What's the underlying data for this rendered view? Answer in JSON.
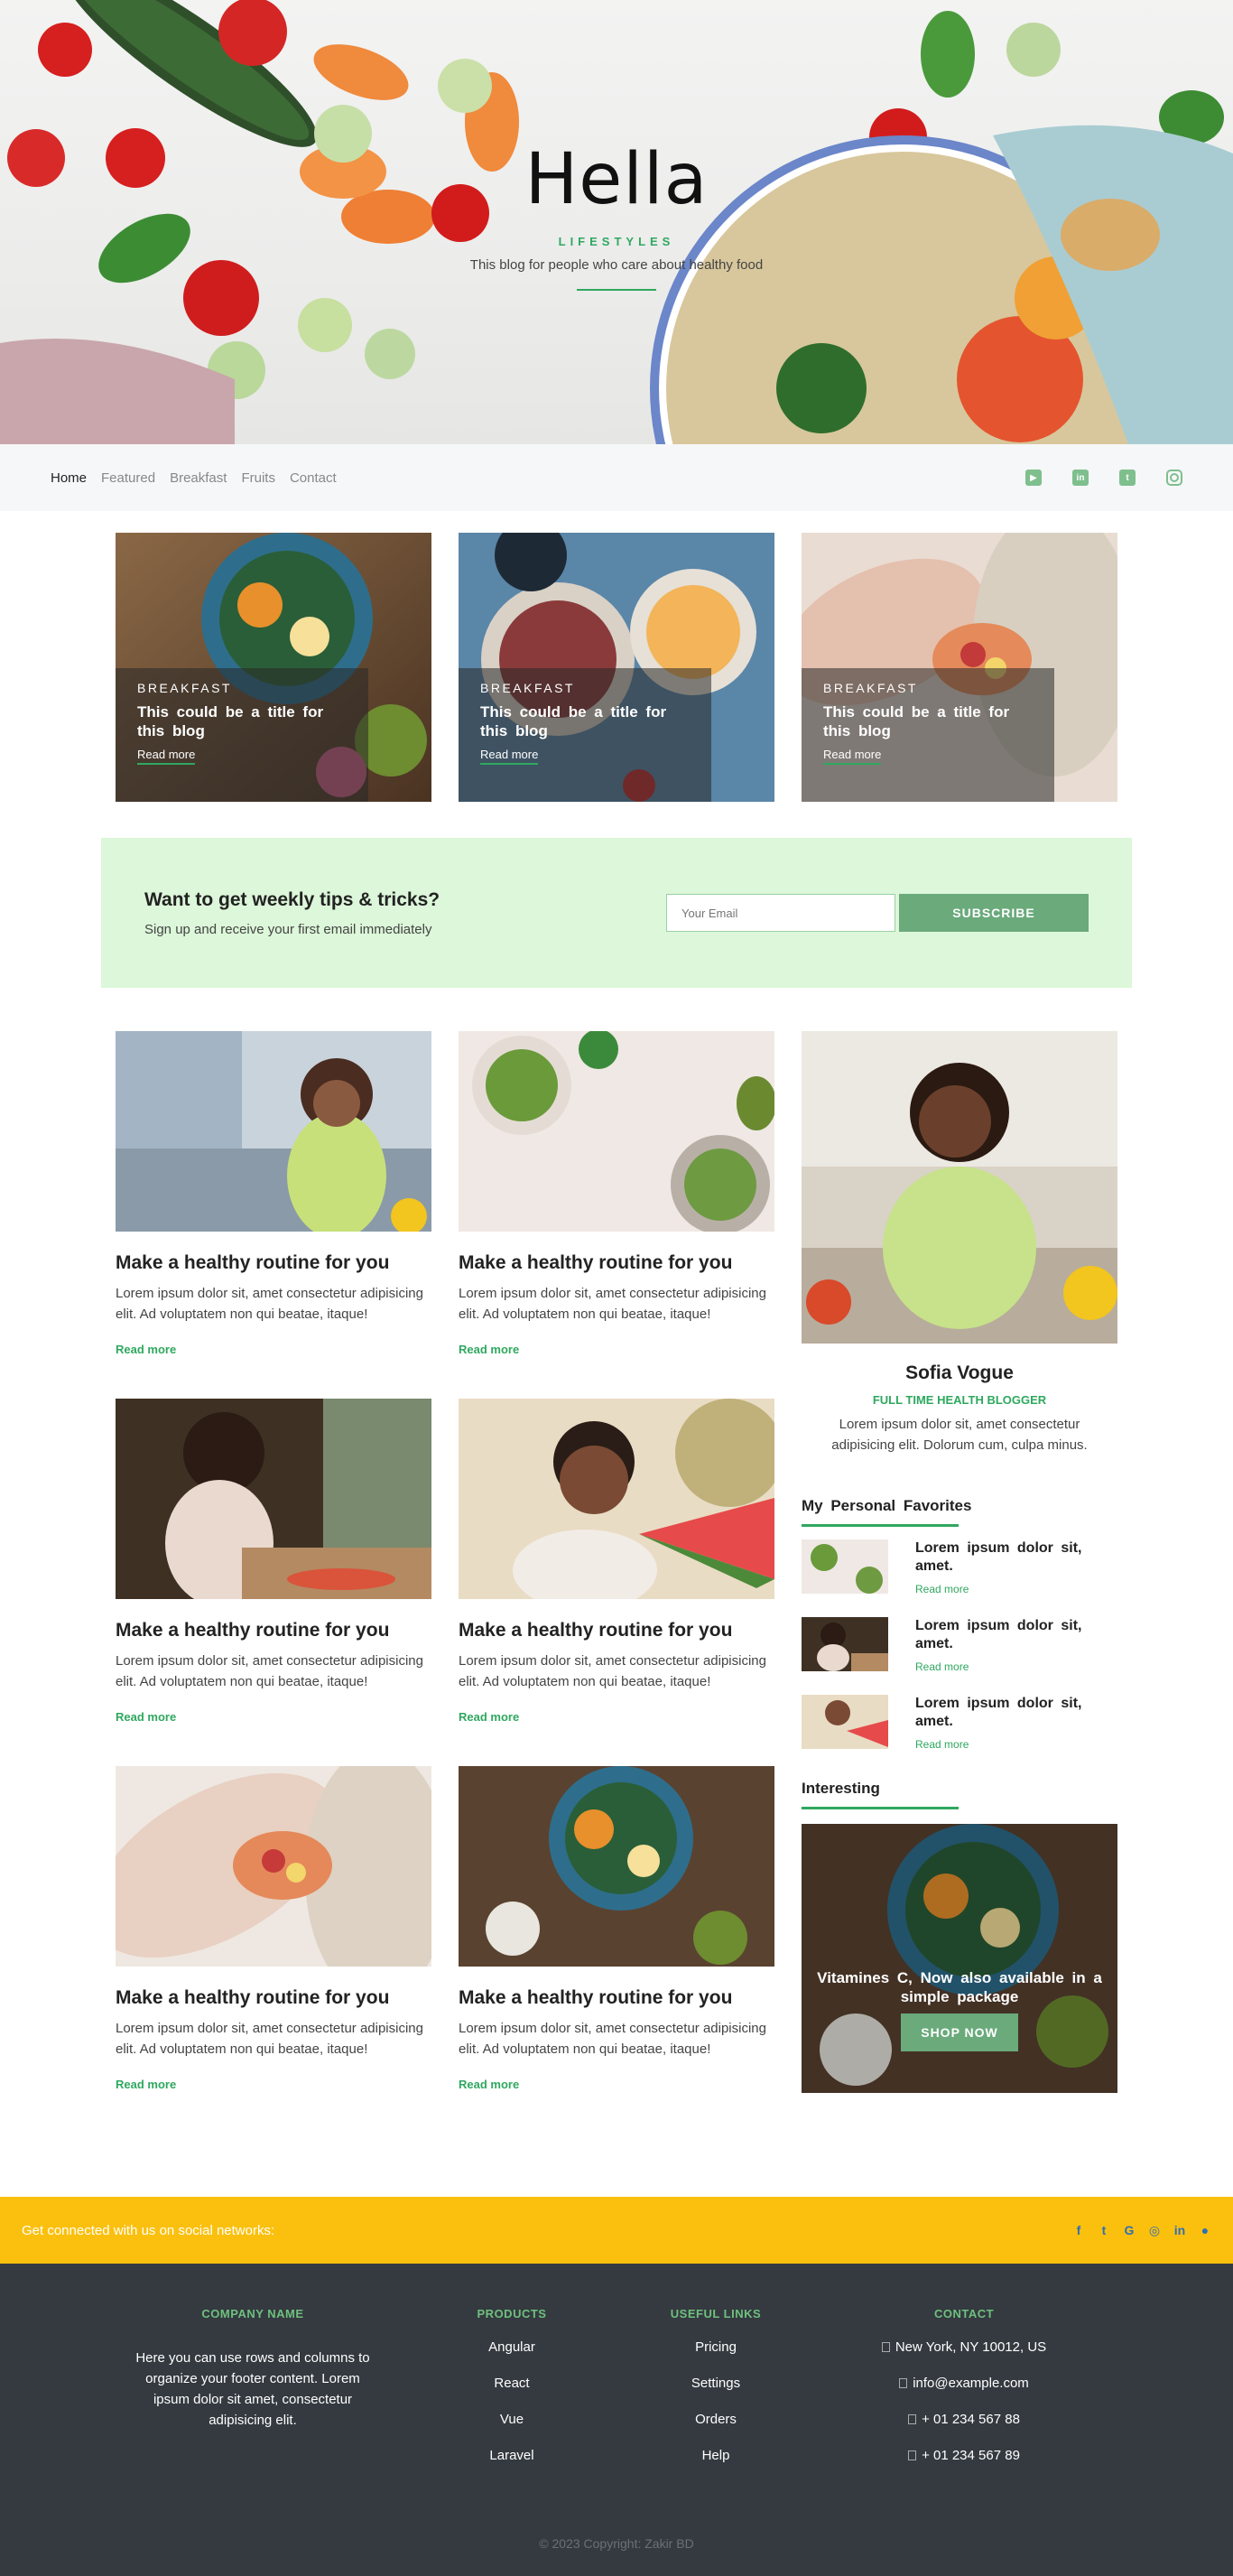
{
  "hero": {
    "title": "Hella",
    "subtitle": "LIFESTYLES",
    "description": "This blog for people who care about healthy food"
  },
  "nav": {
    "links": [
      "Home",
      "Featured",
      "Breakfast",
      "Fruits",
      "Contact"
    ],
    "social_icons": [
      "youtube-icon",
      "linkedin-icon",
      "twitter-icon",
      "instagram-icon"
    ]
  },
  "featured": [
    {
      "category": "BREAKFAST",
      "title": "This could be a title for this blog",
      "link": "Read more"
    },
    {
      "category": "BREAKFAST",
      "title": "This could be a title for this blog",
      "link": "Read more"
    },
    {
      "category": "BREAKFAST",
      "title": "This could be a title for this blog",
      "link": "Read more"
    }
  ],
  "newsletter": {
    "title": "Want to get weekly tips & tricks?",
    "description": "Sign up and receive your first email immediately",
    "placeholder": "Your Email",
    "button": "SUBSCRIBE"
  },
  "posts": [
    {
      "title": "Make a healthy routine for you",
      "text": "Lorem ipsum dolor sit, amet consectetur adipisicing elit. Ad voluptatem non qui beatae, itaque!",
      "link": "Read more"
    },
    {
      "title": "Make a healthy routine for you",
      "text": "Lorem ipsum dolor sit, amet consectetur adipisicing elit. Ad voluptatem non qui beatae, itaque!",
      "link": "Read more"
    },
    {
      "title": "Make a healthy routine for you",
      "text": "Lorem ipsum dolor sit, amet consectetur adipisicing elit. Ad voluptatem non qui beatae, itaque!",
      "link": "Read more"
    },
    {
      "title": "Make a healthy routine for you",
      "text": "Lorem ipsum dolor sit, amet consectetur adipisicing elit. Ad voluptatem non qui beatae, itaque!",
      "link": "Read more"
    },
    {
      "title": "Make a healthy routine for you",
      "text": "Lorem ipsum dolor sit, amet consectetur adipisicing elit. Ad voluptatem non qui beatae, itaque!",
      "link": "Read more"
    },
    {
      "title": "Make a healthy routine for you",
      "text": "Lorem ipsum dolor sit, amet consectetur adipisicing elit. Ad voluptatem non qui beatae, itaque!",
      "link": "Read more"
    }
  ],
  "profile": {
    "name": "Sofia Vogue",
    "role": "FULL TIME HEALTH BLOGGER",
    "bio": "Lorem ipsum dolor sit, amet consectetur adipisicing elit. Dolorum cum, culpa minus."
  },
  "favorites": {
    "heading": "My Personal Favorites",
    "items": [
      {
        "title": "Lorem ipsum dolor sit, amet.",
        "link": "Read more"
      },
      {
        "title": "Lorem ipsum dolor sit, amet.",
        "link": "Read more"
      },
      {
        "title": "Lorem ipsum dolor sit, amet.",
        "link": "Read more"
      }
    ]
  },
  "interesting": {
    "heading": "Interesting",
    "promo_text": "Vitamines C, Now also available in a simple package",
    "button": "SHOP NOW"
  },
  "socialbar": {
    "text": "Get connected with us on social networks:",
    "icons": [
      "facebook-icon",
      "twitter-icon",
      "google-icon",
      "instagram-icon",
      "linkedin-icon",
      "github-icon"
    ]
  },
  "footer": {
    "company": {
      "heading": "COMPANY NAME",
      "text": "Here you can use rows and columns to organize your footer content. Lorem ipsum dolor sit amet, consectetur adipisicing elit."
    },
    "products": {
      "heading": "PRODUCTS",
      "items": [
        "Angular",
        "React",
        "Vue",
        "Laravel"
      ]
    },
    "links": {
      "heading": "USEFUL LINKS",
      "items": [
        "Pricing",
        "Settings",
        "Orders",
        "Help"
      ]
    },
    "contact": {
      "heading": "CONTACT",
      "items": [
        "New York, NY 10012, US",
        "info@example.com",
        "+ 01 234 567 88",
        "+ 01 234 567 89"
      ]
    },
    "copyright": "© 2023 Copyright: Zakir BD"
  },
  "colors": {
    "accent": "#2fa85f",
    "button": "#6aaa7b",
    "newsletter_bg": "#dcf7d9",
    "socialbar_bg": "#fbc00e",
    "footer_bg": "#343a40"
  }
}
